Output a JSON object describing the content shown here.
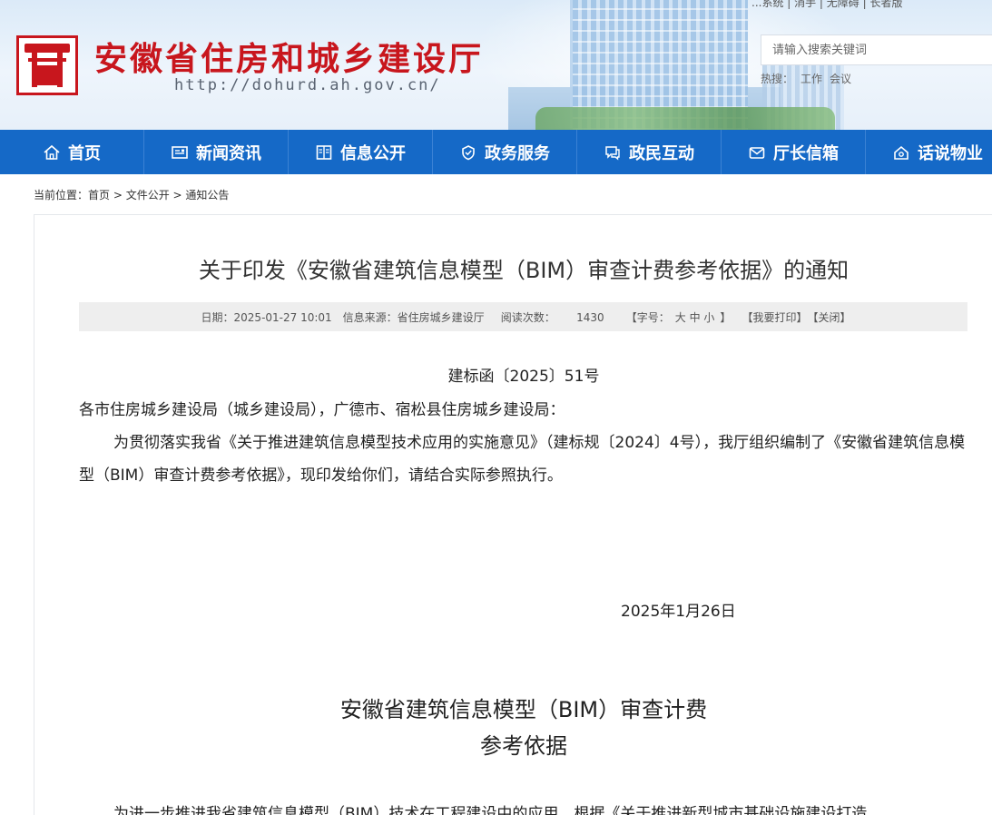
{
  "header": {
    "top_links": "...系统 | 消手 | 无障碍 | 长者版",
    "site_name": "安徽省住房和城乡建设厅",
    "site_url": "http://dohurd.ah.gov.cn/",
    "search": {
      "placeholder": "请输入搜索关键词"
    },
    "hot_label": "热搜：",
    "hot_terms": [
      "工作",
      "会议"
    ]
  },
  "nav": {
    "items": [
      {
        "label": "首页",
        "icon": "home-icon"
      },
      {
        "label": "新闻资讯",
        "icon": "news-icon"
      },
      {
        "label": "信息公开",
        "icon": "book-icon"
      },
      {
        "label": "政务服务",
        "icon": "service-icon"
      },
      {
        "label": "政民互动",
        "icon": "chat-icon"
      },
      {
        "label": "厅长信箱",
        "icon": "mail-icon"
      },
      {
        "label": "话说物业",
        "icon": "property-icon"
      }
    ]
  },
  "breadcrumb": {
    "prefix": "当前位置：",
    "items": [
      "首页",
      "文件公开",
      "通知公告"
    ],
    "separator": " > "
  },
  "article": {
    "title": "关于印发《安徽省建筑信息模型（BIM）审查计费参考依据》的通知",
    "meta": {
      "date": "日期：2025-01-27 10:01",
      "source": "信息来源：省住房城乡建设厅",
      "reads_label": "阅读次数：",
      "reads": "1430",
      "font_size_label": "【字号：",
      "font_large": "大",
      "font_medium": "中",
      "font_small": "小",
      "font_end": "】",
      "print": "【我要打印】",
      "close": "【关闭】"
    },
    "doc_no": "建标函〔2025〕51号",
    "recipient": "各市住房城乡建设局（城乡建设局），广德市、宿松县住房城乡建设局：",
    "body": "为贯彻落实我省《关于推进建筑信息模型技术应用的实施意见》（建标规〔2024〕4号），我厅组织编制了《安徽省建筑信息模型（BIM）审查计费参考依据》，现印发给你们，请结合实际参照执行。",
    "date": "2025年1月26日",
    "sub_title_line1": "安徽省建筑信息模型（BIM）审查计费",
    "sub_title_line2": "参考依据",
    "cut_line": "为进一步推进我省建筑信息模型（BIM）技术在工程建设中的应用，根据《关于推进新型城市基础设施建设打造"
  },
  "colors": {
    "brand_red": "#c8161d",
    "nav_blue": "#1569c7",
    "meta_bg": "#eeeeee"
  }
}
